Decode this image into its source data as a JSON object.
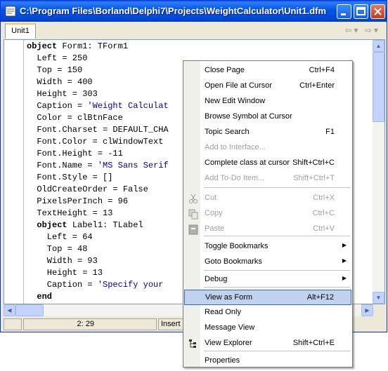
{
  "window": {
    "title": "C:\\Program Files\\Borland\\Delphi7\\Projects\\WeightCalculator\\Unit1.dfm"
  },
  "tabs": [
    {
      "label": "Unit1"
    }
  ],
  "nav": {
    "back": "⇦",
    "forward": "⇨"
  },
  "code_lines": [
    {
      "text": "object Form1: TForm1",
      "kw": "object"
    },
    {
      "text": "  Left = 250"
    },
    {
      "text": "  Top = 150"
    },
    {
      "text": "  Width = 400"
    },
    {
      "text": "  Height = 303"
    },
    {
      "text": "  Caption = 'Weight Calculat"
    },
    {
      "text": "  Color = clBtnFace"
    },
    {
      "text": "  Font.Charset = DEFAULT_CHA"
    },
    {
      "text": "  Font.Color = clWindowText"
    },
    {
      "text": "  Font.Height = -11"
    },
    {
      "text": "  Font.Name = 'MS Sans Serif"
    },
    {
      "text": "  Font.Style = []"
    },
    {
      "text": "  OldCreateOrder = False"
    },
    {
      "text": "  PixelsPerInch = 96"
    },
    {
      "text": "  TextHeight = 13"
    },
    {
      "text": "  object Label1: TLabel",
      "kw": "object"
    },
    {
      "text": "    Left = 64"
    },
    {
      "text": "    Top = 48"
    },
    {
      "text": "    Width = 93"
    },
    {
      "text": "    Height = 13"
    },
    {
      "text": "    Caption = 'Specify your"
    },
    {
      "text": "  end",
      "kw": "end"
    }
  ],
  "status": {
    "position": "2: 29",
    "mode": "Insert"
  },
  "context_menu": {
    "items": [
      {
        "label": "Close Page",
        "shortcut": "Ctrl+F4"
      },
      {
        "label": "Open File at Cursor",
        "shortcut": "Ctrl+Enter"
      },
      {
        "label": "New Edit Window",
        "shortcut": ""
      },
      {
        "label": "Browse Symbol at Cursor",
        "shortcut": ""
      },
      {
        "label": "Topic Search",
        "shortcut": "F1"
      },
      {
        "label": "Add to Interface...",
        "shortcut": "",
        "disabled": true
      },
      {
        "label": "Complete class at cursor",
        "shortcut": "Shift+Ctrl+C"
      },
      {
        "label": "Add To-Do Item...",
        "shortcut": "Shift+Ctrl+T",
        "disabled": true
      },
      {
        "label": "Cut",
        "shortcut": "Ctrl+X",
        "disabled": true,
        "icon": "scissors-icon"
      },
      {
        "label": "Copy",
        "shortcut": "Ctrl+C",
        "disabled": true,
        "icon": "copy-icon"
      },
      {
        "label": "Paste",
        "shortcut": "Ctrl+V",
        "disabled": true,
        "icon": "paste-icon"
      },
      {
        "label": "Toggle Bookmarks",
        "submenu": true
      },
      {
        "label": "Goto Bookmarks",
        "submenu": true
      },
      {
        "label": "Debug",
        "submenu": true
      },
      {
        "label": "View as Form",
        "shortcut": "Alt+F12",
        "highlighted": true
      },
      {
        "label": "Read Only",
        "shortcut": ""
      },
      {
        "label": "Message View",
        "shortcut": ""
      },
      {
        "label": "View Explorer",
        "shortcut": "Shift+Ctrl+E",
        "icon": "explorer-icon"
      },
      {
        "label": "Properties",
        "shortcut": ""
      }
    ]
  },
  "colors": {
    "titlebar": "#0054E3",
    "menu_highlight": "#C1D2EE",
    "menu_highlight_border": "#316AC5",
    "string_color": "#0000A0"
  }
}
